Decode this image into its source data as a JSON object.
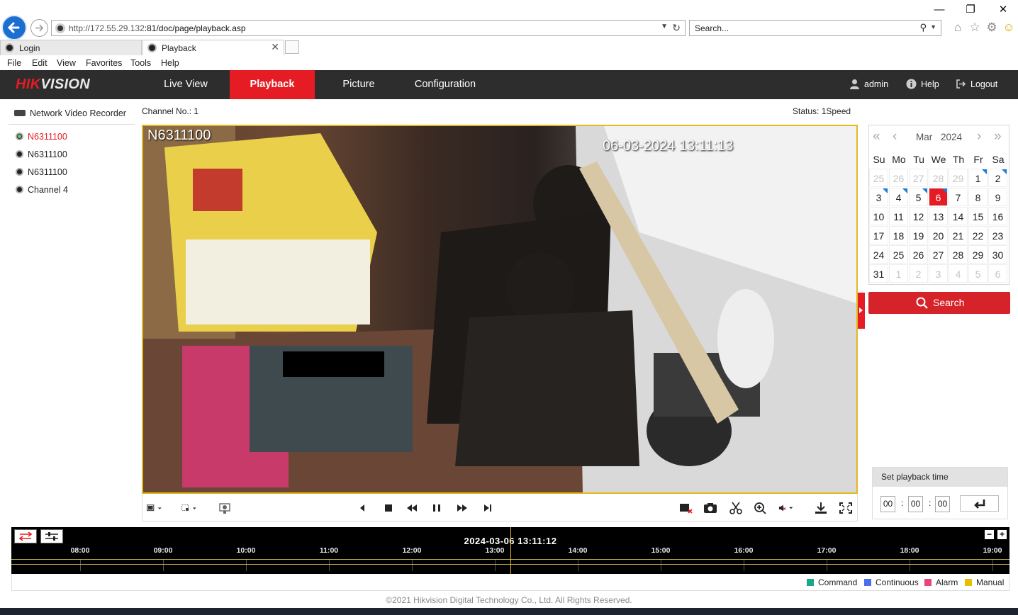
{
  "browser": {
    "url_prefix": "http://172.55.29.132",
    "url_rest": ":81/doc/page/playback.asp",
    "search_placeholder": "Search...",
    "tabs": [
      {
        "label": "Login"
      },
      {
        "label": "Playback"
      }
    ],
    "menu": [
      "File",
      "Edit",
      "View",
      "Favorites",
      "Tools",
      "Help"
    ]
  },
  "header": {
    "logo_red": "HIK",
    "logo_white": "VISION",
    "nav": [
      {
        "label": "Live View",
        "active": false
      },
      {
        "label": "Playback",
        "active": true
      },
      {
        "label": "Picture",
        "active": false
      },
      {
        "label": "Configuration",
        "active": false
      }
    ],
    "user": "admin",
    "help": "Help",
    "logout": "Logout"
  },
  "tree": {
    "root": "Network Video Recorder",
    "channels": [
      {
        "label": "N6311100",
        "selected": true
      },
      {
        "label": "N6311100",
        "selected": false
      },
      {
        "label": "N6311100",
        "selected": false
      },
      {
        "label": "Channel 4",
        "selected": false
      }
    ]
  },
  "player": {
    "channel_label": "Channel No.: 1",
    "status_label": "Status: 1Speed",
    "osd_name": "N6311100",
    "osd_time": "06-03-2024 13:11:13"
  },
  "calendar": {
    "month": "Mar",
    "year": "2024",
    "weekdays": [
      "Su",
      "Mo",
      "Tu",
      "We",
      "Th",
      "Fr",
      "Sa"
    ],
    "days": [
      {
        "d": "25",
        "other": true
      },
      {
        "d": "26",
        "other": true
      },
      {
        "d": "27",
        "other": true
      },
      {
        "d": "28",
        "other": true
      },
      {
        "d": "29",
        "other": true
      },
      {
        "d": "1",
        "rec": true
      },
      {
        "d": "2",
        "rec": true
      },
      {
        "d": "3",
        "rec": true
      },
      {
        "d": "4",
        "rec": true
      },
      {
        "d": "5",
        "rec": true
      },
      {
        "d": "6",
        "today": true,
        "rec": true
      },
      {
        "d": "7"
      },
      {
        "d": "8"
      },
      {
        "d": "9"
      },
      {
        "d": "10"
      },
      {
        "d": "11"
      },
      {
        "d": "12"
      },
      {
        "d": "13"
      },
      {
        "d": "14"
      },
      {
        "d": "15"
      },
      {
        "d": "16"
      },
      {
        "d": "17"
      },
      {
        "d": "18"
      },
      {
        "d": "19"
      },
      {
        "d": "20"
      },
      {
        "d": "21"
      },
      {
        "d": "22"
      },
      {
        "d": "23"
      },
      {
        "d": "24"
      },
      {
        "d": "25"
      },
      {
        "d": "26"
      },
      {
        "d": "27"
      },
      {
        "d": "28"
      },
      {
        "d": "29"
      },
      {
        "d": "30"
      },
      {
        "d": "31"
      },
      {
        "d": "1",
        "other": true
      },
      {
        "d": "2",
        "other": true
      },
      {
        "d": "3",
        "other": true
      },
      {
        "d": "4",
        "other": true
      },
      {
        "d": "5",
        "other": true
      },
      {
        "d": "6",
        "other": true
      }
    ],
    "search_label": "Search"
  },
  "playback_time": {
    "title": "Set playback time",
    "hh": "00",
    "mm": "00",
    "ss": "00"
  },
  "timeline": {
    "current": "2024-03-06 13:11:12",
    "hours": [
      "08:00",
      "09:00",
      "10:00",
      "11:00",
      "12:00",
      "13:00",
      "14:00",
      "15:00",
      "16:00",
      "17:00",
      "18:00",
      "19:00"
    ]
  },
  "legend": [
    {
      "label": "Command",
      "color": "#1aa58c"
    },
    {
      "label": "Continuous",
      "color": "#4a6fe8"
    },
    {
      "label": "Alarm",
      "color": "#e8457a"
    },
    {
      "label": "Manual",
      "color": "#e5c000"
    }
  ],
  "footer": "©2021 Hikvision Digital Technology Co., Ltd. All Rights Reserved.",
  "colors": {
    "brand_red": "#e51c23",
    "header_bg": "#2d2d2d",
    "video_border": "#e5b820"
  }
}
